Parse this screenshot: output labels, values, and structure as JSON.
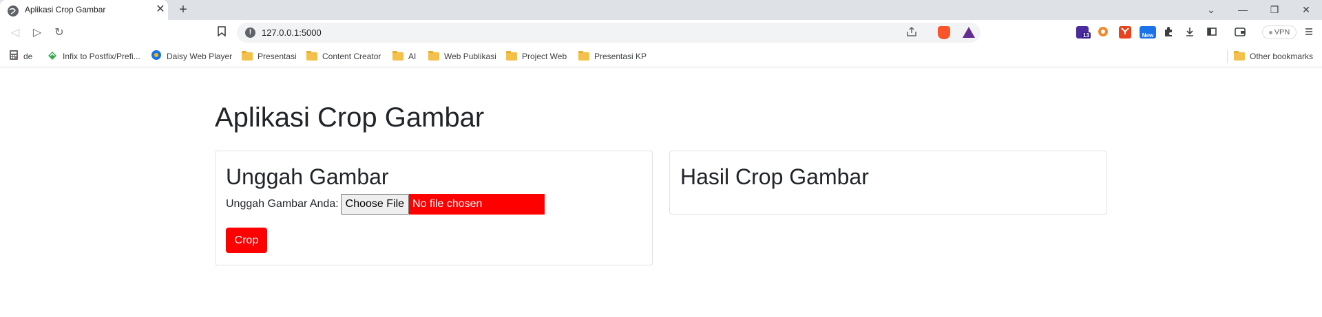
{
  "browser": {
    "tab": {
      "title": "Aplikasi Crop Gambar",
      "close_glyph": "✕"
    },
    "new_tab_glyph": "+",
    "window_controls": {
      "tabsearch_glyph": "⌄",
      "minimize_glyph": "—",
      "restore_glyph": "❐",
      "close_glyph": "✕"
    },
    "nav": {
      "back_glyph": "◁",
      "forward_glyph": "▷",
      "reload_glyph": "↻"
    },
    "address": {
      "url": "127.0.0.1:5000",
      "info_glyph": "!"
    },
    "vpn_label": "VPN",
    "extensions": {
      "badge_count": "13",
      "new_badge": "New"
    },
    "bookmarks": [
      {
        "label": "de",
        "icon": "calculator-icon"
      },
      {
        "label": "Infix to Postfix/Prefi...",
        "icon": "site-icon"
      },
      {
        "label": "Daisy Web Player",
        "icon": "daisy-icon"
      },
      {
        "label": "Presentasi",
        "icon": "folder-icon"
      },
      {
        "label": "Content Creator",
        "icon": "folder-icon"
      },
      {
        "label": "AI",
        "icon": "folder-icon"
      },
      {
        "label": "Web Publikasi",
        "icon": "folder-icon"
      },
      {
        "label": "Project Web",
        "icon": "folder-icon"
      },
      {
        "label": "Presentasi KP",
        "icon": "folder-icon"
      }
    ],
    "other_bookmarks": "Other bookmarks"
  },
  "page": {
    "title": "Aplikasi Crop Gambar",
    "upload_card": {
      "title": "Unggah Gambar",
      "label": "Unggah Gambar Anda:",
      "choose_button": "Choose File",
      "no_file_text": "No file chosen",
      "crop_button": "Crop"
    },
    "result_card": {
      "title": "Hasil Crop Gambar"
    }
  },
  "colors": {
    "accent": "#ff0000",
    "text": "#212529",
    "card_border": "#dee2e6",
    "tabstrip": "#dee1e6"
  }
}
